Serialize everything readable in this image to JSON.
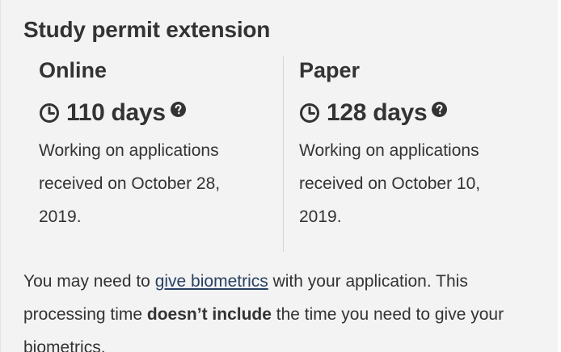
{
  "section": {
    "title": "Study permit extension"
  },
  "online": {
    "heading": "Online",
    "days": "110 days",
    "description": "Working on applications received on October 28, 2019."
  },
  "paper": {
    "heading": "Paper",
    "days": "128 days",
    "description": "Working on applications received on October 10, 2019."
  },
  "note": {
    "prefix": "You may need to ",
    "link_text": "give biometrics",
    "middle": " with your application. This processing time ",
    "bold_text": "doesn’t include",
    "suffix": " the time you need to give your biometrics."
  },
  "icons": {
    "time": "clock-icon",
    "help": "question-circle-icon"
  },
  "colors": {
    "text": "#333333",
    "link": "#284162",
    "panel_background": "#f3f3f3"
  }
}
